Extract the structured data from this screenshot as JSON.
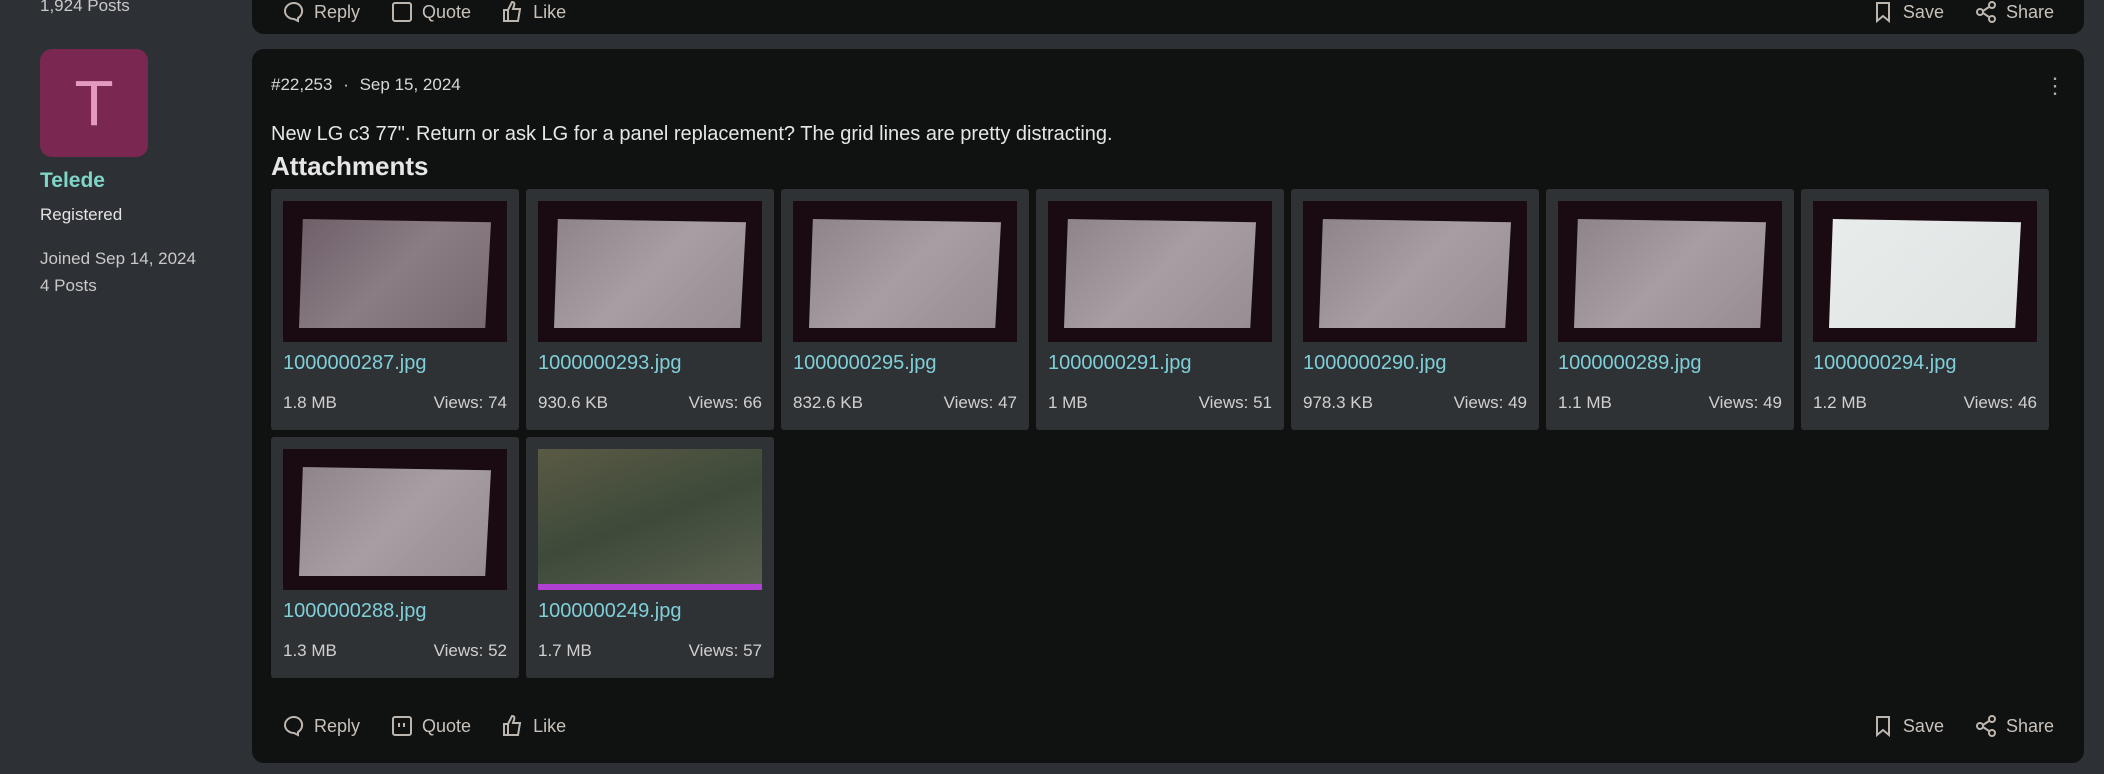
{
  "previous_post": {
    "user_posts": "1,924 Posts",
    "actions": {
      "reply": "Reply",
      "quote": "Quote",
      "like": "Like",
      "save": "Save",
      "share": "Share"
    }
  },
  "user": {
    "avatar_letter": "T",
    "name": "Telede",
    "role": "Registered",
    "joined": "Joined Sep 14, 2024",
    "posts": "4 Posts"
  },
  "post": {
    "number": "#22,253",
    "separator": "·",
    "date": "Sep 15, 2024",
    "text": "New LG c3 77\". Return or ask LG for a panel replacement? The grid lines are pretty distracting.",
    "attachments_heading": "Attachments",
    "attachments": [
      {
        "name": "1000000287.jpg",
        "size": "1.8 MB",
        "views": "Views: 74"
      },
      {
        "name": "1000000293.jpg",
        "size": "930.6 KB",
        "views": "Views: 66"
      },
      {
        "name": "1000000295.jpg",
        "size": "832.6 KB",
        "views": "Views: 47"
      },
      {
        "name": "1000000291.jpg",
        "size": "1 MB",
        "views": "Views: 51"
      },
      {
        "name": "1000000290.jpg",
        "size": "978.3 KB",
        "views": "Views: 49"
      },
      {
        "name": "1000000289.jpg",
        "size": "1.1 MB",
        "views": "Views: 49"
      },
      {
        "name": "1000000294.jpg",
        "size": "1.2 MB",
        "views": "Views: 46"
      },
      {
        "name": "1000000288.jpg",
        "size": "1.3 MB",
        "views": "Views: 52"
      },
      {
        "name": "1000000249.jpg",
        "size": "1.7 MB",
        "views": "Views: 57"
      }
    ],
    "actions": {
      "reply": "Reply",
      "quote": "Quote",
      "like": "Like",
      "save": "Save",
      "share": "Share"
    }
  }
}
